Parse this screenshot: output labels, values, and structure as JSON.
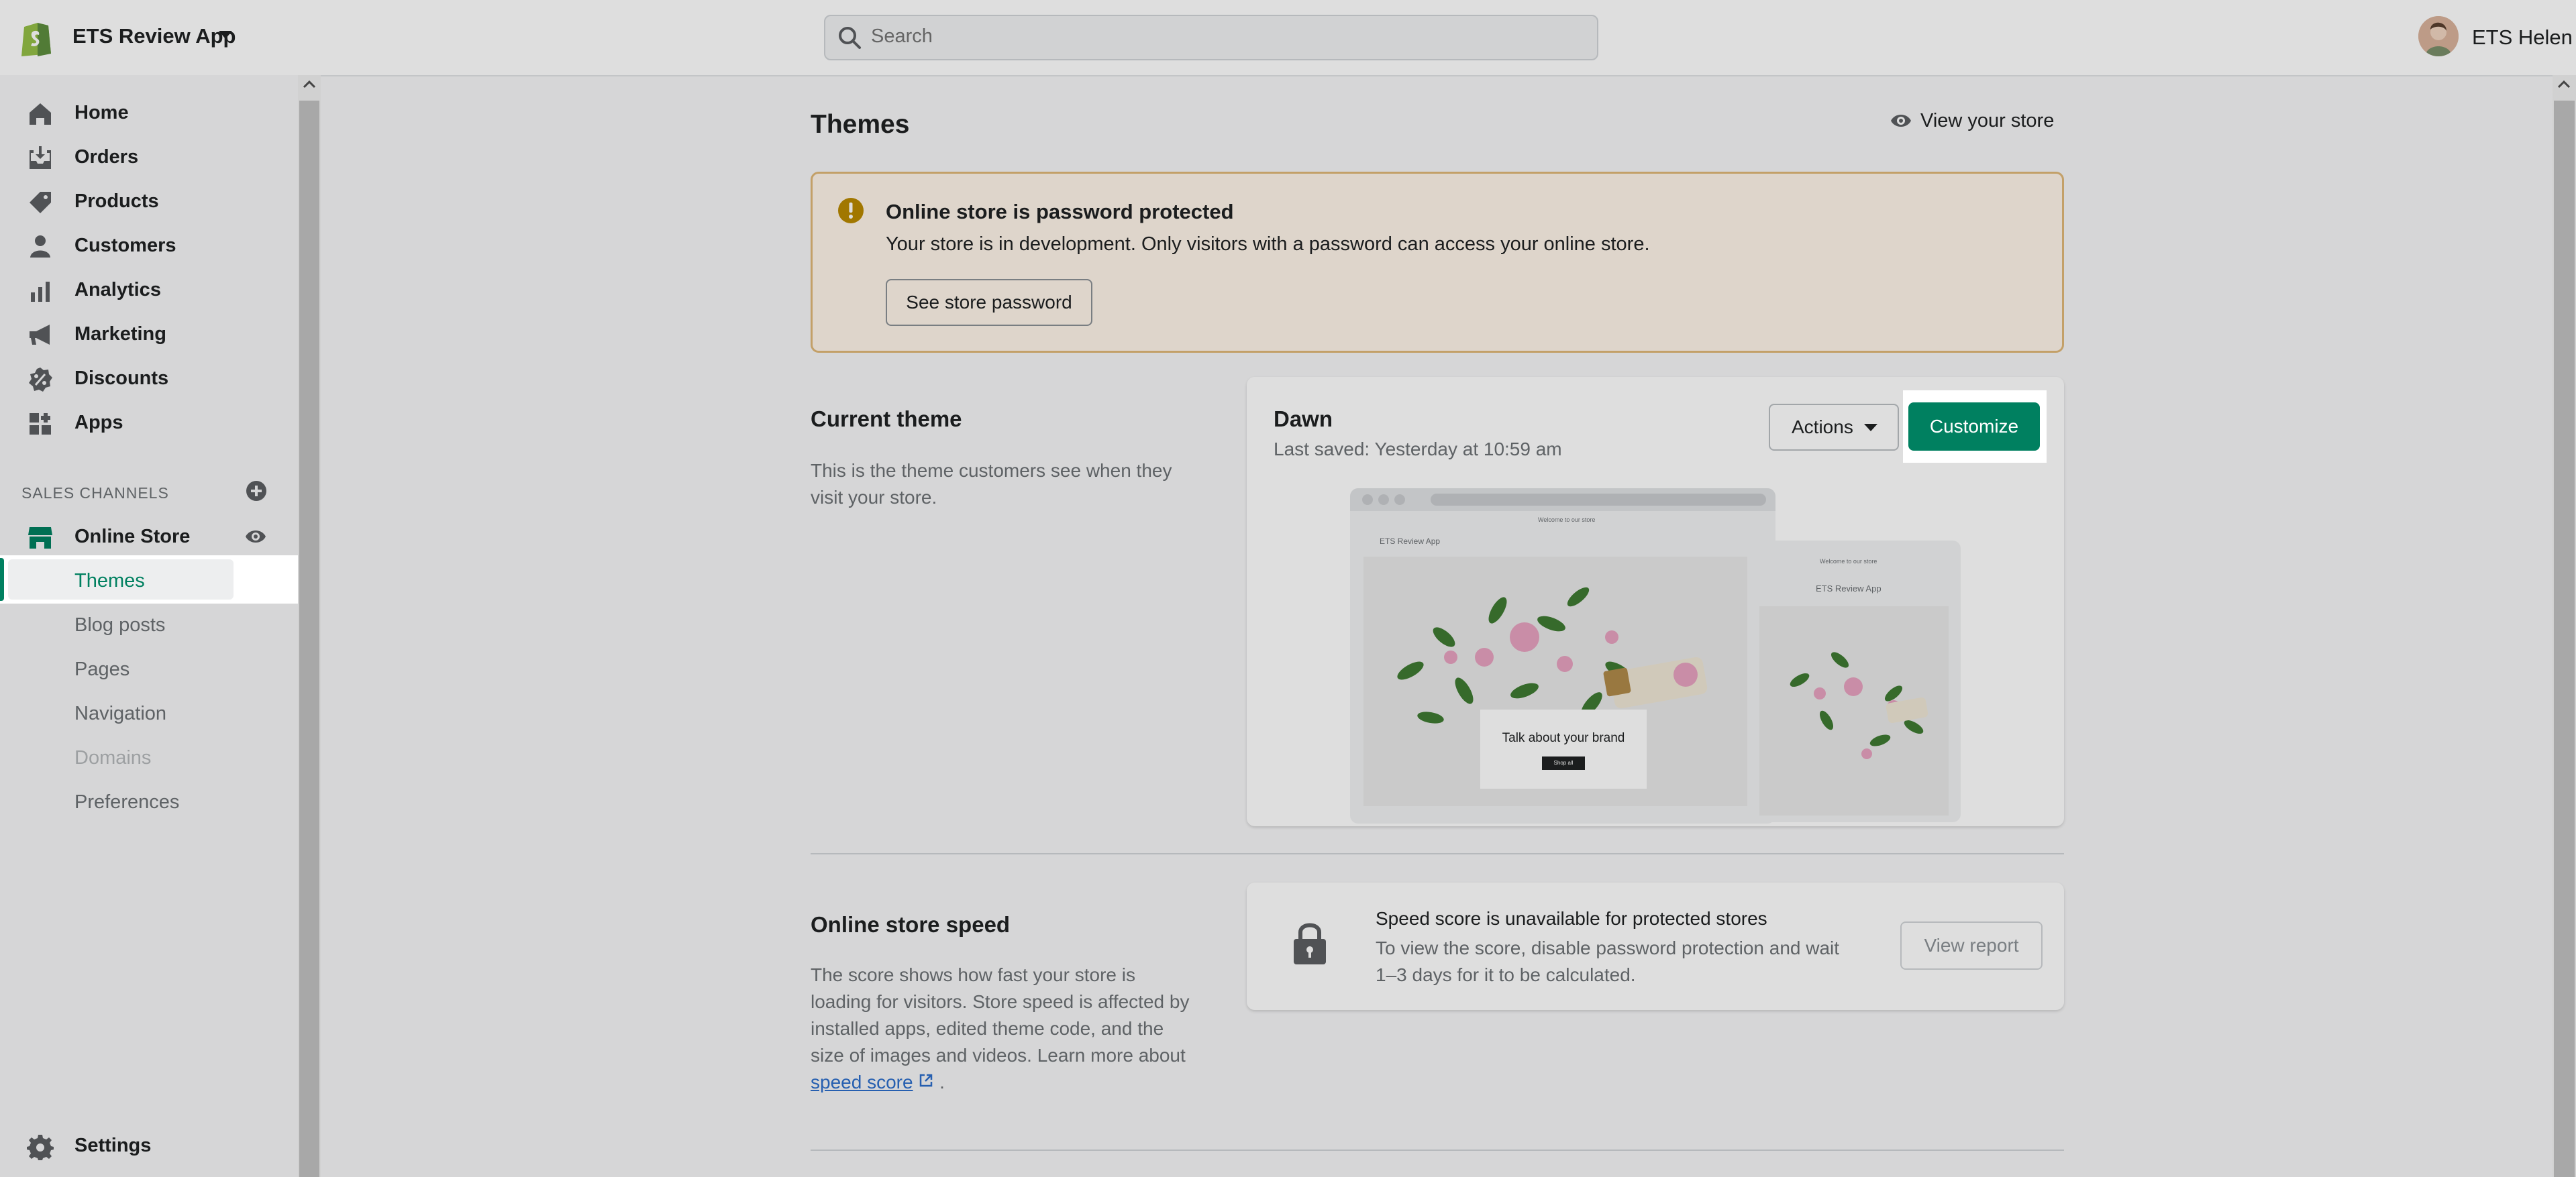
{
  "topbar": {
    "store_name": "ETS Review App",
    "search_placeholder": "Search",
    "user_name": "ETS Helen"
  },
  "sidebar": {
    "main_items": [
      {
        "label": "Home",
        "icon": "home-icon"
      },
      {
        "label": "Orders",
        "icon": "orders-icon"
      },
      {
        "label": "Products",
        "icon": "tag-icon"
      },
      {
        "label": "Customers",
        "icon": "person-icon"
      },
      {
        "label": "Analytics",
        "icon": "bar-chart-icon"
      },
      {
        "label": "Marketing",
        "icon": "megaphone-icon"
      },
      {
        "label": "Discounts",
        "icon": "discount-icon"
      },
      {
        "label": "Apps",
        "icon": "apps-icon"
      }
    ],
    "sales_channels_heading": "SALES CHANNELS",
    "online_store": "Online Store",
    "sub_items": [
      {
        "label": "Themes",
        "active": true
      },
      {
        "label": "Blog posts"
      },
      {
        "label": "Pages"
      },
      {
        "label": "Navigation"
      },
      {
        "label": "Domains",
        "disabled": true
      },
      {
        "label": "Preferences"
      }
    ],
    "settings": "Settings"
  },
  "main": {
    "title": "Themes",
    "view_store": "View your store",
    "banner": {
      "title": "Online store is password protected",
      "text": "Your store is in development. Only visitors with a password can access your online store.",
      "button": "See store password"
    },
    "current_theme": {
      "heading": "Current theme",
      "description_line1": "This is the theme customers see when they",
      "description_line2": "visit your store.",
      "theme_name": "Dawn",
      "last_saved": "Last saved: Yesterday at 10:59 am",
      "actions": "Actions",
      "customize": "Customize",
      "preview_desktop_store": "ETS Review App",
      "preview_mobile_store": "ETS Review App",
      "preview_announcement": "Welcome to our store",
      "preview_banner_text": "Talk about your brand",
      "preview_button": "Shop all"
    },
    "speed": {
      "heading": "Online store speed",
      "desc_line1": "The score shows how fast your store is",
      "desc_line2": "loading for visitors. Store speed is affected by",
      "desc_line3": "installed apps, edited theme code, and the",
      "desc_line4": "size of images and videos. Learn more about",
      "link": "speed score",
      "card_title": "Speed score is unavailable for protected stores",
      "card_text_line1": "To view the score, disable password protection and wait",
      "card_text_line2": "1–3 days for it to be calculated.",
      "view_report": "View report"
    }
  },
  "colors": {
    "brand_green": "#008060",
    "banner_bg": "#fff5ea",
    "banner_border": "#e1b878",
    "link_blue": "#2c6ecb"
  }
}
